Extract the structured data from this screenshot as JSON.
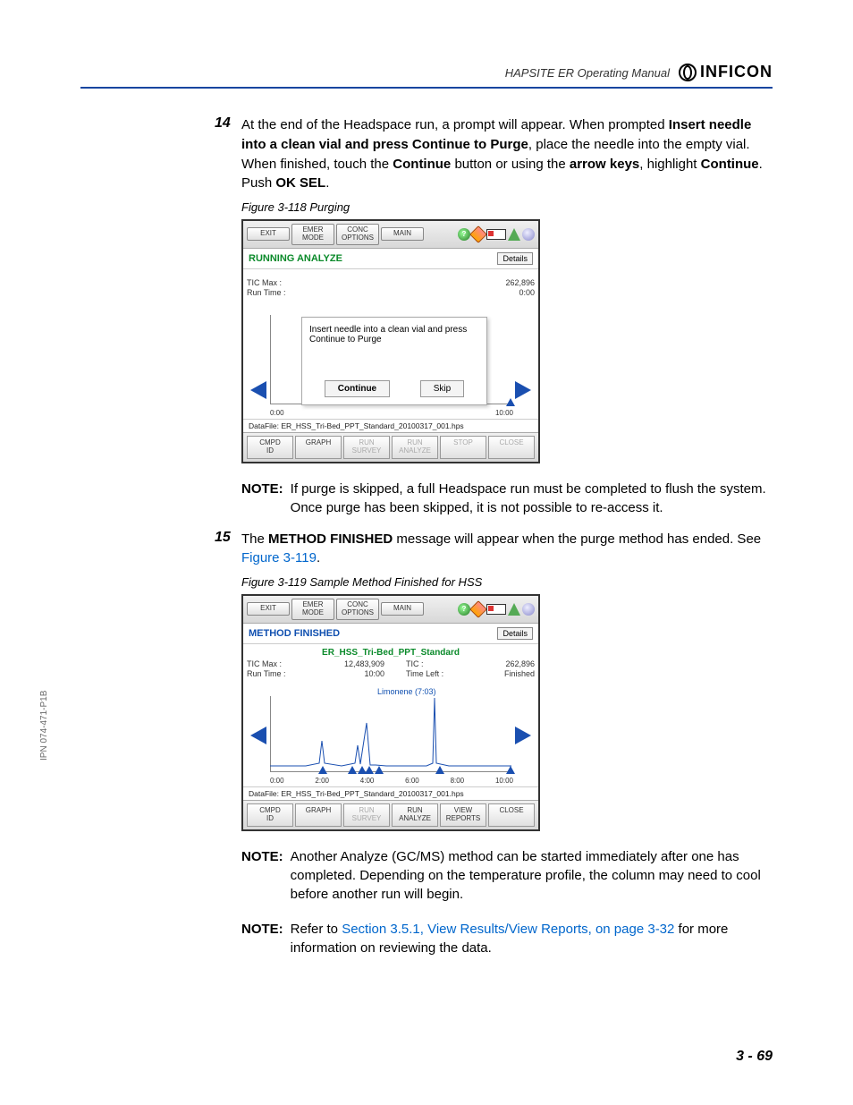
{
  "header": {
    "doc_title": "HAPSITE ER Operating Manual",
    "brand": "INFICON"
  },
  "side_text": "IPN 074-471-P1B",
  "page_num": "3 - 69",
  "step14": {
    "num": "14",
    "t1": "At the end of the Headspace run, a prompt will appear. When prompted ",
    "b1": "Insert needle into a clean vial and press Continue to Purge",
    "t2": ", place the needle into the empty vial. When finished, touch the ",
    "b2": "Continue",
    "t3": " button or using the ",
    "b3": "arrow keys",
    "t4": ", highlight ",
    "b4": "Continue",
    "t5": ". Push ",
    "b5": "OK SEL",
    "t6": "."
  },
  "fig118": {
    "caption": "Figure 3-118  Purging"
  },
  "ss1": {
    "toolbar": {
      "exit": "EXIT",
      "emer": "EMER\nMODE",
      "conc": "CONC\nOPTIONS",
      "main": "MAIN"
    },
    "status": "RUNNING ANALYZE",
    "details": "Details",
    "left_labels": {
      "l1": "TIC Max :",
      "l2": "Run Time :"
    },
    "right_vals": {
      "v1": "262,896",
      "v2": "0:00"
    },
    "popup_msg": "Insert needle into a clean vial and press Continue to Purge",
    "popup_continue": "Continue",
    "popup_skip": "Skip",
    "ticks": {
      "start": "0:00",
      "end": "10:00"
    },
    "datafile": "DataFile: ER_HSS_Tri-Bed_PPT_Standard_20100317_001.hps",
    "bottom": {
      "cmpd": "CMPD\nID",
      "graph": "GRAPH",
      "survey": "RUN\nSURVEY",
      "analyze": "RUN\nANALYZE",
      "stop": "STOP",
      "close": "CLOSE"
    }
  },
  "note1": {
    "label": "NOTE:",
    "text": "If purge is skipped, a full Headspace run must be completed to flush the system. Once purge has been skipped, it is not possible to re-access it."
  },
  "step15": {
    "num": "15",
    "t1": "The ",
    "b1": "METHOD FINISHED",
    "t2": " message will appear when the purge method has ended. See ",
    "link": "Figure 3-119",
    "t3": "."
  },
  "fig119": {
    "caption": "Figure 3-119  Sample Method Finished for HSS"
  },
  "ss2": {
    "toolbar": {
      "exit": "EXIT",
      "emer": "EMER\nMODE",
      "conc": "CONC\nOPTIONS",
      "main": "MAIN"
    },
    "status": "METHOD FINISHED",
    "details": "Details",
    "method_name": "ER_HSS_Tri-Bed_PPT_Standard",
    "left_labels": {
      "l1": "TIC Max :",
      "l2": "Run Time :"
    },
    "mid_vals": {
      "m1": "12,483,909",
      "m2": "10:00"
    },
    "r_labels": {
      "r1": "TIC :",
      "r2": "Time Left :"
    },
    "right_vals": {
      "v1": "262,896",
      "v2": "Finished"
    },
    "peak_label": "Limonene (7:03)",
    "ticks": {
      "t0": "0:00",
      "t1": "2:00",
      "t2": "4:00",
      "t3": "6:00",
      "t4": "8:00",
      "t5": "10:00"
    },
    "datafile": "DataFile: ER_HSS_Tri-Bed_PPT_Standard_20100317_001.hps",
    "bottom": {
      "cmpd": "CMPD\nID",
      "graph": "GRAPH",
      "survey": "RUN\nSURVEY",
      "analyze": "RUN\nANALYZE",
      "reports": "VIEW\nREPORTS",
      "close": "CLOSE"
    }
  },
  "note2": {
    "label": "NOTE:",
    "text": "Another Analyze (GC/MS) method can be started immediately after one has completed. Depending on the temperature profile, the column may need to cool before another run will begin."
  },
  "note3": {
    "label": "NOTE:",
    "t1": "Refer to ",
    "link": "Section 3.5.1, View Results/View Reports, on page 3-32",
    "t2": " for more information on reviewing the data."
  }
}
